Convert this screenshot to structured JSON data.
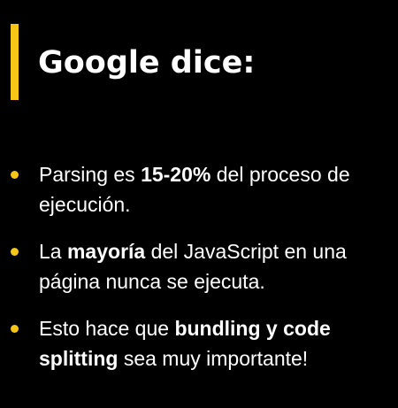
{
  "slide": {
    "title": "Google dice:",
    "accent_color": "#f5c518",
    "background_color": "#000000",
    "text_color": "#ffffff",
    "bullets": [
      {
        "parts": [
          {
            "text": "Parsing es ",
            "bold": false
          },
          {
            "text": "15-20%",
            "bold": true
          },
          {
            "text": " del proceso de ejecución.",
            "bold": false
          }
        ]
      },
      {
        "parts": [
          {
            "text": "La ",
            "bold": false
          },
          {
            "text": "mayoría",
            "bold": true
          },
          {
            "text": " del JavaScript en una página nunca se ejecuta.",
            "bold": false
          }
        ]
      },
      {
        "parts": [
          {
            "text": "Esto hace que ",
            "bold": false
          },
          {
            "text": "bundling y code splitting",
            "bold": true
          },
          {
            "text": " sea muy importante!",
            "bold": false
          }
        ]
      }
    ]
  }
}
